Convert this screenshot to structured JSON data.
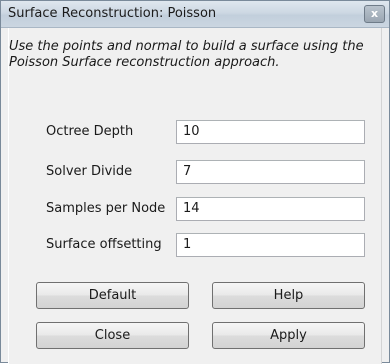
{
  "window": {
    "title": "Surface Reconstruction: Poisson",
    "close_glyph": "x"
  },
  "description": "Use the points and normal to build a surface using the Poisson Surface reconstruction approach.",
  "fields": [
    {
      "label": "Octree Depth",
      "value": "10"
    },
    {
      "label": "Solver Divide",
      "value": "7"
    },
    {
      "label": "Samples per Node",
      "value": "14"
    },
    {
      "label": "Surface offsetting",
      "value": "1"
    }
  ],
  "buttons": {
    "default": "Default",
    "help": "Help",
    "close": "Close",
    "apply": "Apply"
  }
}
